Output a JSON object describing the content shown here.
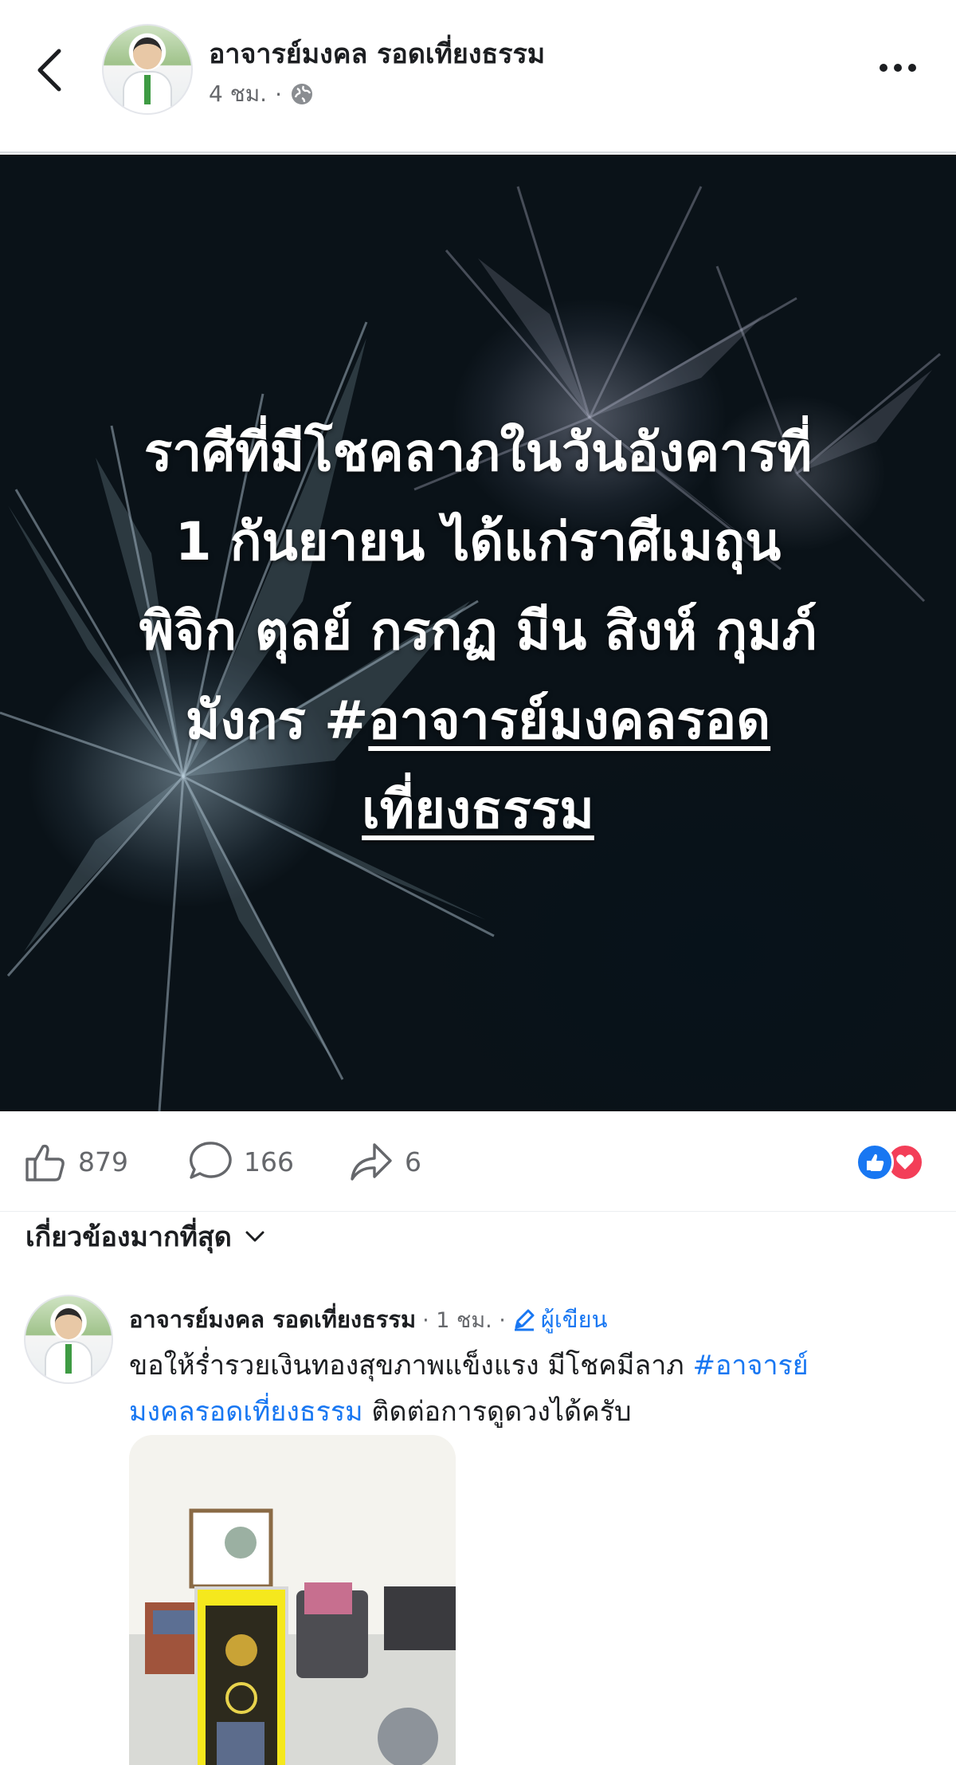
{
  "header": {
    "author": "อาจารย์มงคล รอดเที่ยงธรรม",
    "time": "4 ชม.",
    "separator": "·",
    "privacy_icon": "globe-icon"
  },
  "post": {
    "overlay_line1": "ราศีที่มีโชคลาภในวันอังคารที่",
    "overlay_line2": "1 กันยายน ได้แก่ราศีเมถุน",
    "overlay_line3": "พิจิก ตุลย์ กรกฏ มีน สิงห์ กุมภ์",
    "overlay_line4_prefix": "มังกร  #",
    "overlay_hashtag_part1": "อาจารย์มงคลรอด",
    "overlay_hashtag_part2": "เที่ยงธรรม"
  },
  "actions": {
    "like_count": "879",
    "comment_count": "166",
    "share_count": "6",
    "reaction_types": [
      "like",
      "love"
    ],
    "like_color": "#1877f2",
    "love_color": "#f33e58"
  },
  "sort": {
    "label": "เกี่ยวข้องมากที่สุด"
  },
  "comment": {
    "author": "อาจารย์มงคล รอดเที่ยงธรรม",
    "time": "· 1 ชม. ·",
    "badge": "ผู้เขียน",
    "text_part1": "ขอให้ร่ำรวยเงินทองสุขภาพแข็งแรง  มีโชคมีลาภ ",
    "hashtag_part1": "#อาจารย์",
    "hashtag_part2": "มงคลรอดเที่ยงธรรม",
    "text_part2": "  ติดต่อการดูดวงได้ครับ"
  }
}
